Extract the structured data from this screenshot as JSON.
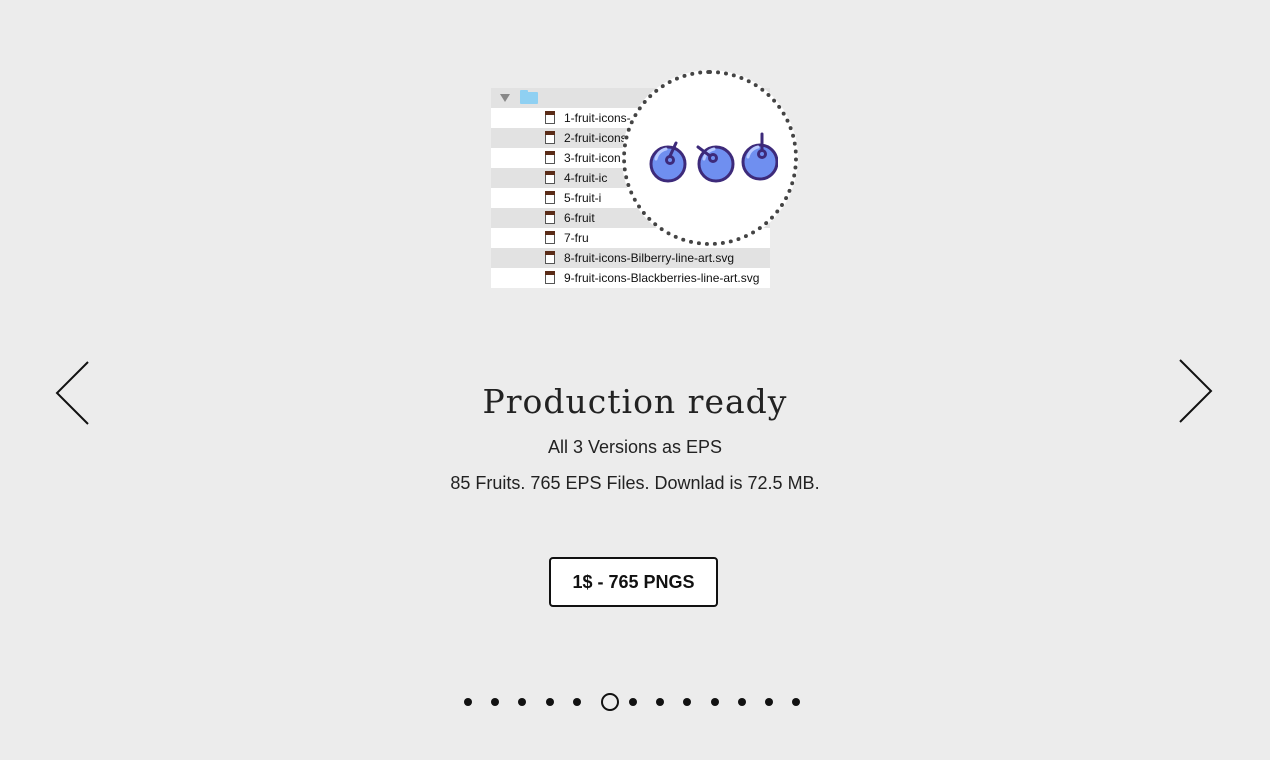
{
  "file_list": {
    "files": [
      "1-fruit-icons-",
      "2-fruit-icons",
      "3-fruit-icon",
      "4-fruit-ic",
      "5-fruit-i",
      "6-fruit",
      "7-fru",
      "8-fruit-icons-Bilberry-line-art.svg",
      "9-fruit-icons-Blackberries-line-art.svg"
    ]
  },
  "slide": {
    "title": "Production ready",
    "subtitle": "All 3 Versions as EPS",
    "details": "85 Fruits. 765 EPS Files. Downlad is 72.5 MB.",
    "button_label": "1$ - 765 PNGS"
  },
  "pagination": {
    "total": 13,
    "active_index": 5
  },
  "colors": {
    "background": "#ececec",
    "berry_fill": "#6f8ff0",
    "berry_outline": "#3d2a7a",
    "folder": "#8fd0f2"
  }
}
